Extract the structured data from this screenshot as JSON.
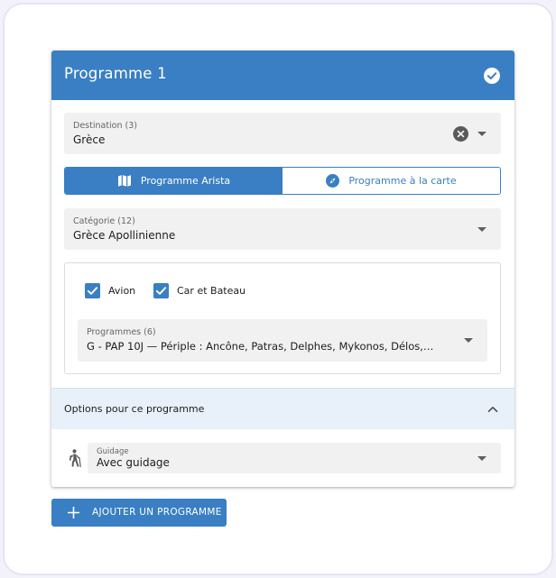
{
  "card": {
    "title": "Programme 1"
  },
  "destination": {
    "label": "Destination (3)",
    "value": "Grèce"
  },
  "program_type": {
    "options": [
      "Programme Arista",
      "Programme à la carte"
    ],
    "selected": "Programme Arista"
  },
  "category": {
    "label": "Catégorie (12)",
    "value": "Grèce Apollinienne"
  },
  "transport": {
    "options": [
      {
        "label": "Avion",
        "checked": true
      },
      {
        "label": "Car et Bateau",
        "checked": true
      }
    ]
  },
  "programmes": {
    "label": "Programmes (6)",
    "value": "G - PAP 10J — Périple : Ancône, Patras, Delphes, Mykonos, Délos,…"
  },
  "options_section": {
    "title": "Options pour ce programme",
    "expanded": true
  },
  "guidage": {
    "label": "Guidage",
    "value": "Avec guidage"
  },
  "add_button": {
    "label": "AJOUTER UN PROGRAMME"
  },
  "colors": {
    "primary": "#3a7fc3",
    "options_band": "#e8f1fa",
    "field_bg": "#f1f1f1"
  },
  "icons": {
    "header": "check-circle-icon",
    "destination_clear": "clear-circle-icon",
    "arista": "map-icon",
    "a_la_carte": "compass-icon",
    "options_toggle": "chevron-up-icon",
    "guidage": "hiker-icon",
    "add": "plus-icon"
  }
}
